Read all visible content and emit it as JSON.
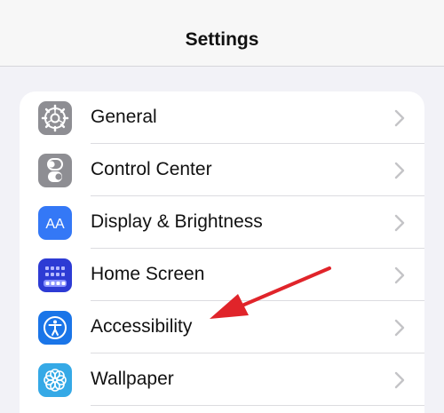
{
  "header": {
    "title": "Settings"
  },
  "rows": [
    {
      "label": "General",
      "icon": "gear-icon",
      "color": "#8e8e93"
    },
    {
      "label": "Control Center",
      "icon": "toggles-icon",
      "color": "#8e8e93"
    },
    {
      "label": "Display & Brightness",
      "icon": "text-size-icon",
      "color": "#3478f6"
    },
    {
      "label": "Home Screen",
      "icon": "app-grid-icon",
      "color": "#2d3bd4"
    },
    {
      "label": "Accessibility",
      "icon": "accessibility-icon",
      "color": "#1a75e8"
    },
    {
      "label": "Wallpaper",
      "icon": "flower-icon",
      "color": "#35a9e6"
    }
  ],
  "icon_text": {
    "display": "AA"
  },
  "annotation": {
    "arrow_color": "#e0242a",
    "points_to": "Accessibility"
  }
}
